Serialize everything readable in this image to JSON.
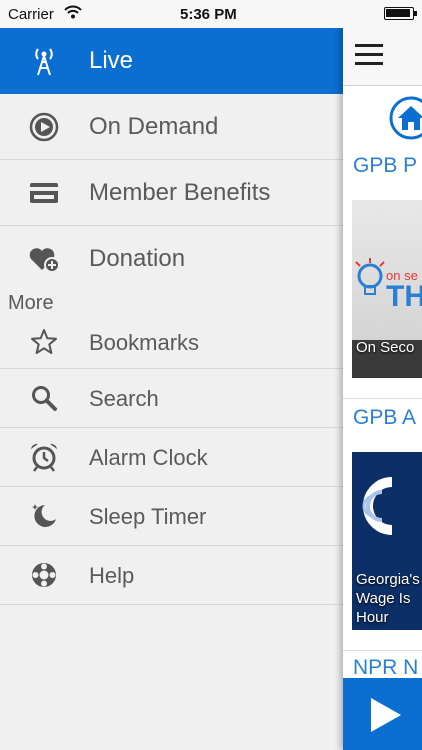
{
  "status_bar": {
    "carrier": "Carrier",
    "time": "5:36 PM",
    "battery_level": 0.95
  },
  "menu": {
    "items": [
      {
        "label": "Live",
        "icon": "antenna-icon",
        "active": true
      },
      {
        "label": "On Demand",
        "icon": "play-circle-icon"
      },
      {
        "label": "Member Benefits",
        "icon": "card-icon"
      },
      {
        "label": "Donation",
        "icon": "heart-plus-icon"
      }
    ],
    "more_header": "More",
    "more_items": [
      {
        "label": "Bookmarks",
        "icon": "star-icon"
      },
      {
        "label": "Search",
        "icon": "search-icon"
      },
      {
        "label": "Alarm Clock",
        "icon": "alarm-clock-icon"
      },
      {
        "label": "Sleep Timer",
        "icon": "moon-icon"
      },
      {
        "label": "Help",
        "icon": "lifebuoy-icon"
      }
    ]
  },
  "content": {
    "sections": [
      {
        "title": "GPB P",
        "caption": [
          "On Seco"
        ],
        "thumb_text_small": "on se",
        "thumb_text_big": "TH"
      },
      {
        "title": "GPB A",
        "caption": [
          "Georgia's",
          "Wage Is",
          "Hour"
        ]
      },
      {
        "title": "NPR N"
      }
    ]
  },
  "colors": {
    "accent": "#0a6fd1",
    "link": "#2a7fd4",
    "menu_bg": "#f0f0f0"
  }
}
